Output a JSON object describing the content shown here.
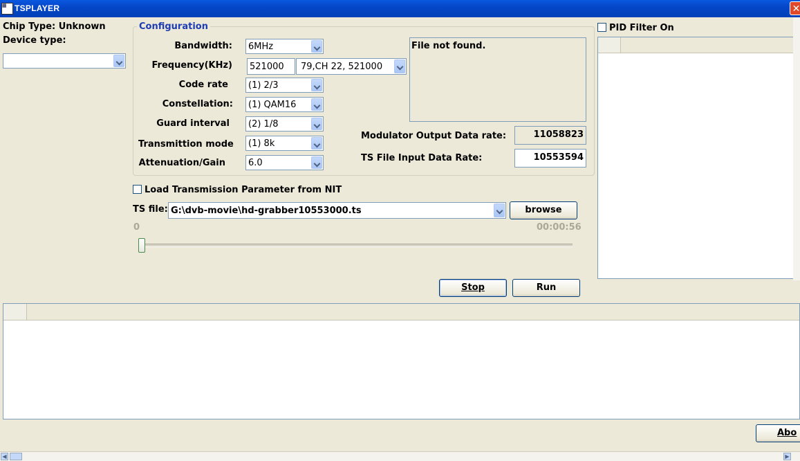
{
  "window": {
    "title": "TSPLAYER"
  },
  "chip": {
    "type_label": "Chip Type: Unknown",
    "device_label": "Device type:",
    "device_value": ""
  },
  "config": {
    "group_title": "Configuration",
    "bandwidth_label": "Bandwidth:",
    "bandwidth_value": "6MHz",
    "frequency_label": "Frequency(KHz)",
    "frequency_value": "521000",
    "channel_value": "79,CH 22, 521000",
    "coderate_label": "Code rate",
    "coderate_value": "(1) 2/3",
    "constellation_label": "Constellation:",
    "constellation_value": "(1) QAM16",
    "guard_label": "Guard interval",
    "guard_value": "(2) 1/8",
    "txmode_label": "Transmittion mode",
    "txmode_value": "(1) 8k",
    "atten_label": "Attenuation/Gain",
    "atten_value": "6.0",
    "status_message": "File not found.",
    "mod_rate_label": "Modulator Output Data rate:",
    "mod_rate_value": "11058823",
    "ts_rate_label": "TS File Input Data Rate:",
    "ts_rate_value": "10553594"
  },
  "nit": {
    "label": "Load Transmission Parameter from NIT",
    "checked": false
  },
  "tsfile": {
    "label": "TS file:",
    "value": "G:\\dvb-movie\\hd-grabber10553000.ts",
    "browse_label": "browse"
  },
  "progress": {
    "start_label": "0",
    "end_label": "00:00:56",
    "position": 0.0
  },
  "buttons": {
    "stop_label": "Stop",
    "run_label": "Run",
    "about_label": "Abo"
  },
  "pid": {
    "label": "PID Filter On",
    "checked": false
  }
}
